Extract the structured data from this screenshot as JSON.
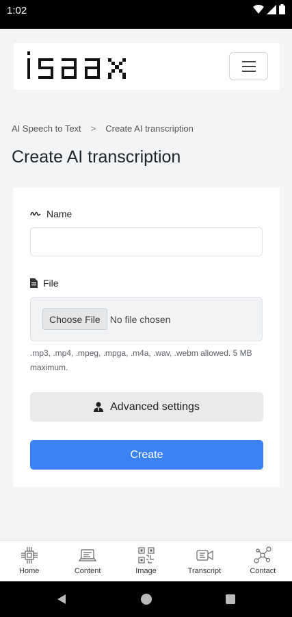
{
  "status_bar": {
    "time": "1:02"
  },
  "header": {
    "logo_text": "isaax",
    "menu_icon": "hamburger-icon"
  },
  "breadcrumb": {
    "items": [
      "AI Speech to Text",
      "Create AI transcription"
    ],
    "separator": ">"
  },
  "page": {
    "title": "Create AI transcription"
  },
  "form": {
    "name_label": "Name",
    "name_value": "",
    "file_label": "File",
    "choose_file_label": "Choose File",
    "no_file_text": "No file chosen",
    "file_help": ".mp3, .mp4, .mpeg, .mpga, .m4a, .wav, .webm allowed. 5 MB maximum.",
    "advanced_label": "Advanced settings",
    "submit_label": "Create"
  },
  "bottom_nav": {
    "items": [
      {
        "label": "Home",
        "icon": "chip-icon"
      },
      {
        "label": "Content",
        "icon": "laptop-icon"
      },
      {
        "label": "Image",
        "icon": "qr-image-icon"
      },
      {
        "label": "Transcript",
        "icon": "video-icon"
      },
      {
        "label": "Contact",
        "icon": "network-icon"
      }
    ]
  },
  "colors": {
    "primary": "#3b82f6",
    "background": "#f3f4f6"
  }
}
